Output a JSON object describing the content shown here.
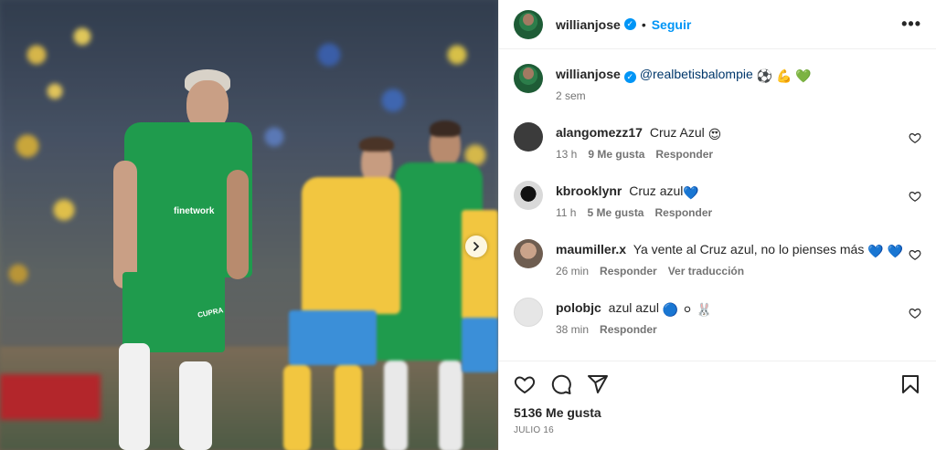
{
  "post": {
    "author": "willianjose",
    "follow_label": "Seguir",
    "separator": "•",
    "more_label": "•••",
    "caption": {
      "mention": "@realbetisbalompie",
      "emojis": "⚽ 💪 💚",
      "time": "2 sem"
    },
    "likes": "5136 Me gusta",
    "date": "JULIO 16",
    "image": {
      "shirt_text": "finetwork",
      "shorts_text": "CUPRA"
    }
  },
  "comments": [
    {
      "user": "alangomezz17",
      "text": "Cruz Azul",
      "emoji": "😍",
      "time": "13 h",
      "likes": "9 Me gusta",
      "reply": "Responder",
      "avatar_color": "#3b3b3b"
    },
    {
      "user": "kbrooklynr",
      "text": "Cruz azul",
      "emoji": "💙",
      "time": "11 h",
      "likes": "5 Me gusta",
      "reply": "Responder",
      "avatar_color": "#1f1f1f"
    },
    {
      "user": "maumiller.x",
      "text": "Ya vente al Cruz azul, no lo pienses más",
      "emoji": "💙 💙",
      "time": "26 min",
      "reply": "Responder",
      "translate": "Ver traducción",
      "avatar_color": "#7d6b5e"
    },
    {
      "user": "polobjc",
      "text": "azul azul",
      "emoji": "🔵 ⚪ 🐰",
      "time": "38 min",
      "reply": "Responder",
      "avatar_color": "#e6e6e6"
    }
  ],
  "colors": {
    "accent": "#0095f6",
    "mention": "#00376b",
    "muted": "#737373",
    "betis_green": "#1f9b4d",
    "cadiz_yellow": "#f2c640"
  },
  "icons": [
    "heart-icon",
    "comment-icon",
    "share-icon",
    "bookmark-icon",
    "chevron-right-icon",
    "more-icon",
    "verified-icon"
  ]
}
